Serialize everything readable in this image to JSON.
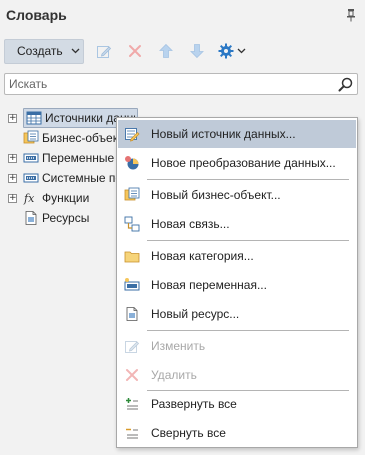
{
  "panel": {
    "title": "Словарь"
  },
  "toolbar": {
    "create_label": "Создать"
  },
  "search": {
    "placeholder": "Искать"
  },
  "tree": {
    "items": [
      {
        "label": "Источники данных"
      },
      {
        "label": "Бизнес-объекты"
      },
      {
        "label": "Переменные"
      },
      {
        "label": "Системные переменные"
      },
      {
        "label": "Функции"
      },
      {
        "label": "Ресурсы"
      }
    ]
  },
  "context_menu": {
    "items": [
      {
        "label": "Новый источник данных..."
      },
      {
        "label": "Новое преобразование данных..."
      },
      {
        "label": "Новый бизнес-объект..."
      },
      {
        "label": "Новая связь..."
      },
      {
        "label": "Новая категория..."
      },
      {
        "label": "Новая переменная..."
      },
      {
        "label": "Новый ресурс..."
      },
      {
        "label": "Изменить"
      },
      {
        "label": "Удалить"
      },
      {
        "label": "Развернуть все"
      },
      {
        "label": "Свернуть все"
      }
    ]
  },
  "colors": {
    "accent": "#2b78c5",
    "hover": "#bfcad8",
    "delete": "#e57373",
    "disabled": "#a8a8a8"
  }
}
